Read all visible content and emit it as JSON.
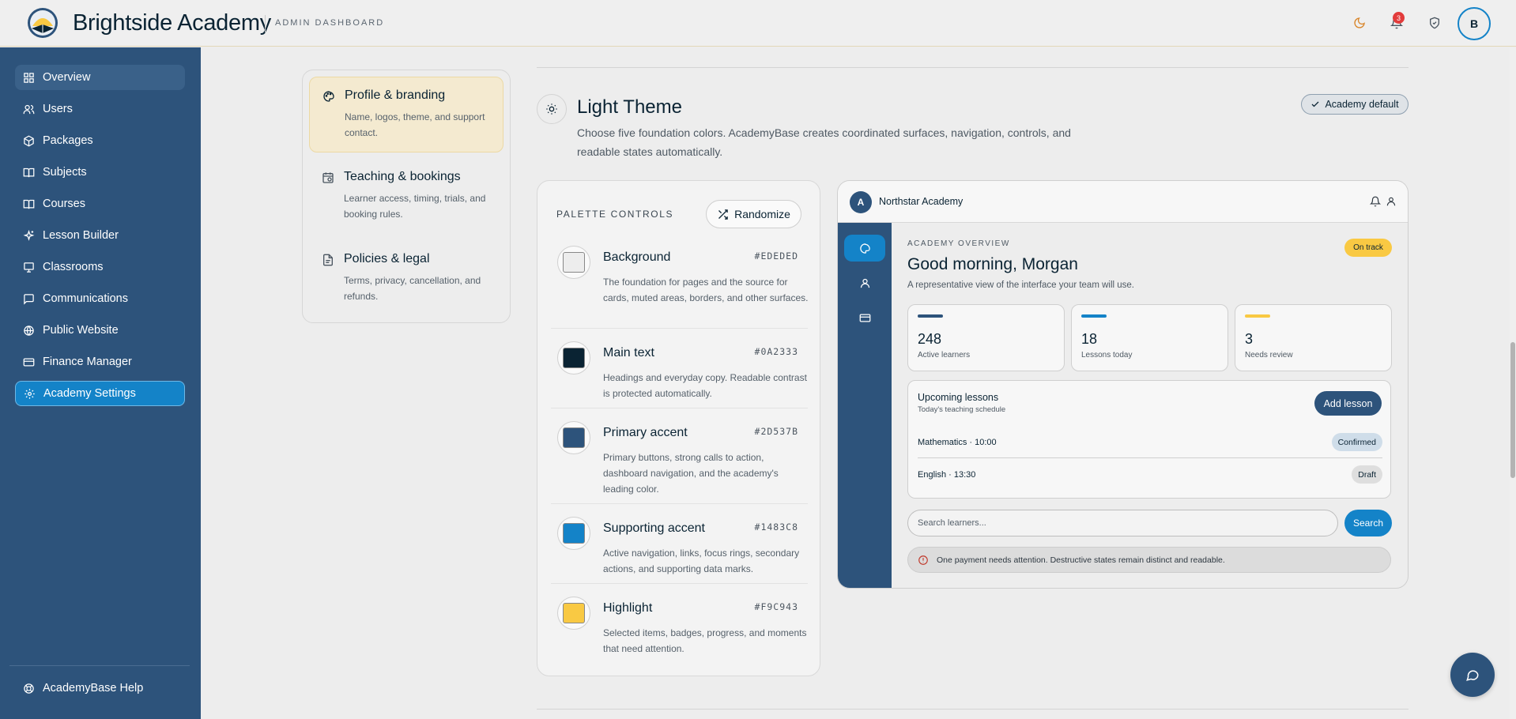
{
  "header": {
    "brand": "Brightside Academy",
    "subtitle": "ADMIN DASHBOARD",
    "notification_count": "3",
    "avatar_initial": "B",
    "icons": [
      "moon-icon",
      "bell-icon",
      "shield-check-icon"
    ]
  },
  "sidebar": {
    "items": [
      {
        "label": "Overview",
        "icon": "grid-icon"
      },
      {
        "label": "Users",
        "icon": "users-icon"
      },
      {
        "label": "Packages",
        "icon": "package-icon"
      },
      {
        "label": "Subjects",
        "icon": "book-open-icon"
      },
      {
        "label": "Courses",
        "icon": "book-open-icon"
      },
      {
        "label": "Lesson Builder",
        "icon": "sparkles-icon"
      },
      {
        "label": "Classrooms",
        "icon": "presentation-icon"
      },
      {
        "label": "Communications",
        "icon": "message-icon"
      },
      {
        "label": "Public Website",
        "icon": "globe-icon"
      },
      {
        "label": "Finance Manager",
        "icon": "card-icon"
      },
      {
        "label": "Academy Settings",
        "icon": "settings-icon"
      }
    ],
    "active": "Academy Settings",
    "help": "AcademyBase Help"
  },
  "settings_nav": [
    {
      "title": "Profile & branding",
      "desc": "Name, logos, theme, and support contact."
    },
    {
      "title": "Teaching & bookings",
      "desc": "Learner access, timing, trials, and booking rules."
    },
    {
      "title": "Policies & legal",
      "desc": "Terms, privacy, cancellation, and refunds."
    }
  ],
  "theme": {
    "title": "Light Theme",
    "description": "Choose five foundation colors. AcademyBase creates coordinated surfaces, navigation, controls, and readable states automatically.",
    "default_label": "Academy default"
  },
  "palette": {
    "title": "PALETTE CONTROLS",
    "randomize": "Randomize",
    "rows": [
      {
        "name": "Background",
        "hex": "#EDEDED",
        "desc": "The foundation for pages and the source for cards, muted areas, borders, and other surfaces."
      },
      {
        "name": "Main text",
        "hex": "#0A2333",
        "desc": "Headings and everyday copy. Readable contrast is protected automatically."
      },
      {
        "name": "Primary accent",
        "hex": "#2D537B",
        "desc": "Primary buttons, strong calls to action, dashboard navigation, and the academy's leading color."
      },
      {
        "name": "Supporting accent",
        "hex": "#1483C8",
        "desc": "Active navigation, links, focus rings, secondary actions, and supporting data marks."
      },
      {
        "name": "Highlight",
        "hex": "#F9C943",
        "desc": "Selected items, badges, progress, and moments that need attention."
      }
    ]
  },
  "preview": {
    "logo_initial": "A",
    "org_name": "Northstar Academy",
    "kicker": "ACADEMY OVERVIEW",
    "greeting": "Good morning, Morgan",
    "subtitle": "A representative view of the interface your team will use.",
    "status_badge": "On track",
    "stats": [
      {
        "value": "248",
        "label": "Active learners",
        "color": "#2D537B"
      },
      {
        "value": "18",
        "label": "Lessons today",
        "color": "#1483C8"
      },
      {
        "value": "3",
        "label": "Needs review",
        "color": "#F9C943"
      }
    ],
    "lessons_title": "Upcoming lessons",
    "lessons_sub": "Today's teaching schedule",
    "add_lesson": "Add lesson",
    "lessons": [
      {
        "name": "Mathematics · 10:00",
        "status": "Confirmed"
      },
      {
        "name": "English · 13:30",
        "status": "Draft"
      }
    ],
    "search_placeholder": "Search learners...",
    "search_button": "Search",
    "alert": "One payment needs attention. Destructive states remain distinct and readable."
  }
}
